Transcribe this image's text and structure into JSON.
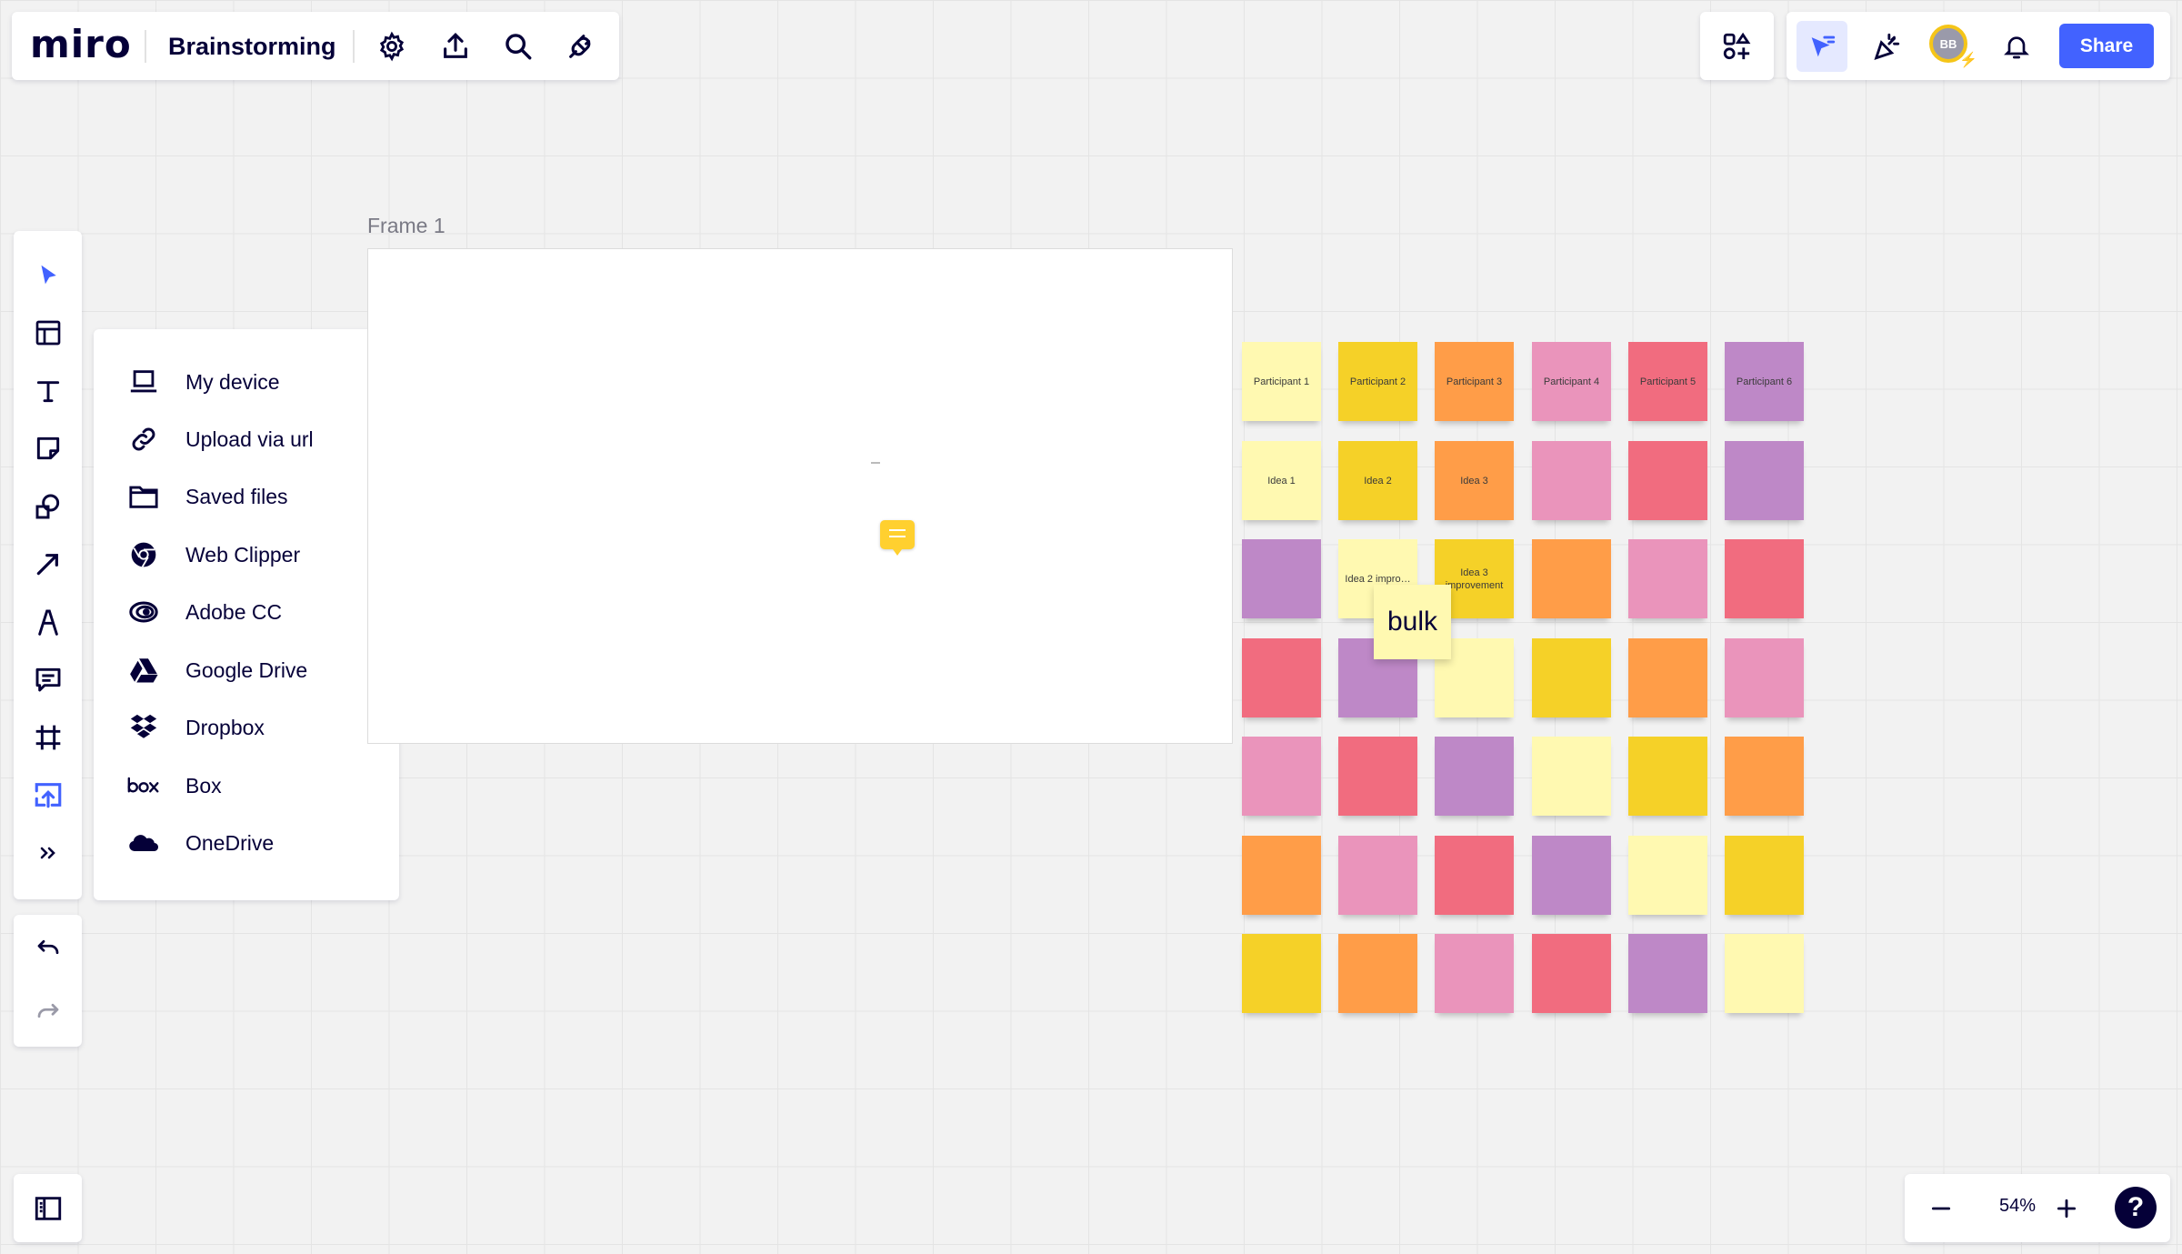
{
  "app": {
    "logo": "miro",
    "board_title": "Brainstorming"
  },
  "topbar": {
    "icons": [
      "settings-icon",
      "export-icon",
      "search-icon",
      "plugin-icon"
    ]
  },
  "header_right": {
    "apps_icon": "apps-icon",
    "tools": [
      "cursor-follow-icon",
      "celebrate-icon"
    ],
    "avatar_initials": "BB",
    "notification_icon": "bell-icon",
    "share_label": "Share",
    "accent_color": "#4262ff"
  },
  "toolbar": {
    "tools": [
      "select-icon",
      "templates-icon",
      "text-icon",
      "sticky-note-icon",
      "shapes-icon",
      "arrow-icon",
      "pen-icon",
      "comment-icon",
      "frame-icon",
      "upload-icon",
      "more-icon"
    ],
    "active_tool": "upload-icon",
    "undo_icon": "undo-icon",
    "redo_icon": "redo-icon"
  },
  "upload_menu": {
    "items": [
      {
        "icon": "laptop-icon",
        "label": "My device"
      },
      {
        "icon": "link-icon",
        "label": "Upload via url"
      },
      {
        "icon": "folder-icon",
        "label": "Saved files"
      },
      {
        "icon": "chrome-icon",
        "label": "Web Clipper"
      },
      {
        "icon": "adobe-cc-icon",
        "label": "Adobe CC"
      },
      {
        "icon": "google-drive-icon",
        "label": "Google Drive"
      },
      {
        "icon": "dropbox-icon",
        "label": "Dropbox"
      },
      {
        "icon": "box-icon",
        "label": "Box"
      },
      {
        "icon": "onedrive-icon",
        "label": "OneDrive"
      }
    ]
  },
  "canvas": {
    "frame_title": "Frame 1",
    "sticky_colors": {
      "light_yellow": "#fff9b1",
      "yellow": "#f5d128",
      "orange": "#ff9d48",
      "pink": "#ea94bb",
      "red": "#f16c7f",
      "violet": "#be88c7"
    },
    "sticky_rows": [
      [
        {
          "c": "light_yellow",
          "t": "Participant 1"
        },
        {
          "c": "yellow",
          "t": "Participant 2"
        },
        {
          "c": "orange",
          "t": "Participant 3"
        },
        {
          "c": "pink",
          "t": "Participant 4"
        },
        {
          "c": "red",
          "t": "Participant 5"
        },
        {
          "c": "violet",
          "t": "Participant 6"
        }
      ],
      [
        {
          "c": "light_yellow",
          "t": "Idea 1"
        },
        {
          "c": "yellow",
          "t": "Idea 2"
        },
        {
          "c": "orange",
          "t": "Idea 3"
        },
        {
          "c": "pink",
          "t": ""
        },
        {
          "c": "red",
          "t": ""
        },
        {
          "c": "violet",
          "t": ""
        }
      ],
      [
        {
          "c": "violet",
          "t": ""
        },
        {
          "c": "light_yellow",
          "t": "Idea 2 impro…"
        },
        {
          "c": "yellow",
          "t": "Idea 3 improvement"
        },
        {
          "c": "orange",
          "t": ""
        },
        {
          "c": "pink",
          "t": ""
        },
        {
          "c": "red",
          "t": ""
        }
      ],
      [
        {
          "c": "red",
          "t": ""
        },
        {
          "c": "violet",
          "t": ""
        },
        {
          "c": "light_yellow",
          "t": ""
        },
        {
          "c": "yellow",
          "t": ""
        },
        {
          "c": "orange",
          "t": ""
        },
        {
          "c": "pink",
          "t": ""
        }
      ],
      [
        {
          "c": "pink",
          "t": ""
        },
        {
          "c": "red",
          "t": ""
        },
        {
          "c": "violet",
          "t": ""
        },
        {
          "c": "light_yellow",
          "t": ""
        },
        {
          "c": "yellow",
          "t": ""
        },
        {
          "c": "orange",
          "t": ""
        }
      ],
      [
        {
          "c": "orange",
          "t": ""
        },
        {
          "c": "pink",
          "t": ""
        },
        {
          "c": "red",
          "t": ""
        },
        {
          "c": "violet",
          "t": ""
        },
        {
          "c": "light_yellow",
          "t": ""
        },
        {
          "c": "yellow",
          "t": ""
        }
      ],
      [
        {
          "c": "yellow",
          "t": ""
        },
        {
          "c": "orange",
          "t": ""
        },
        {
          "c": "pink",
          "t": ""
        },
        {
          "c": "red",
          "t": ""
        },
        {
          "c": "violet",
          "t": ""
        },
        {
          "c": "light_yellow",
          "t": ""
        }
      ]
    ],
    "bulk_note": "bulk",
    "comment_icon": "comment-marker-icon"
  },
  "bottom": {
    "sidebar_icon": "sidebar-toggle-icon",
    "zoom_out_icon": "minus-icon",
    "zoom_level": "54%",
    "zoom_in_icon": "plus-icon",
    "help_label": "?"
  }
}
